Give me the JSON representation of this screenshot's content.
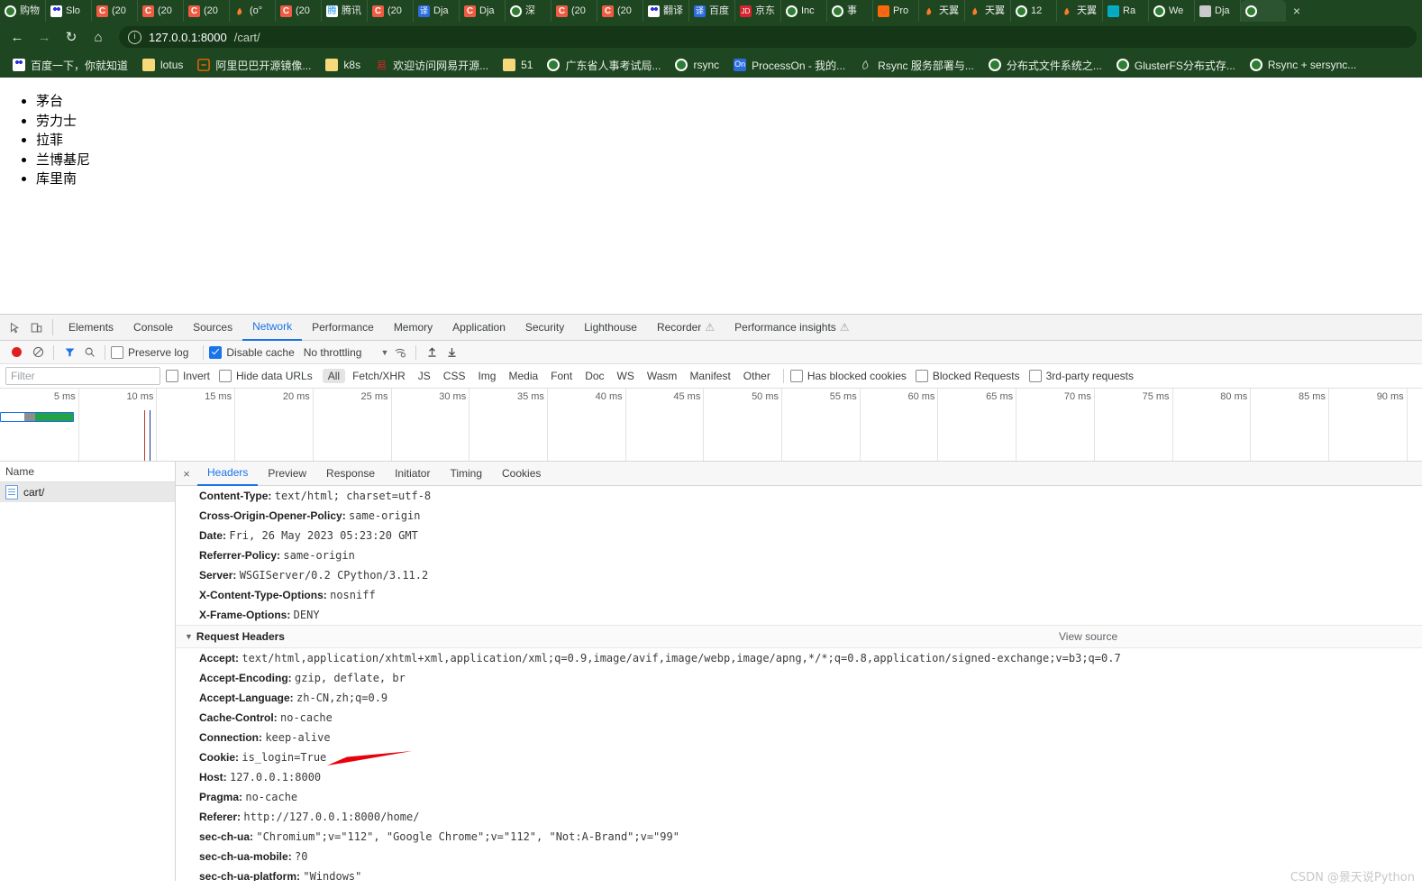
{
  "browser": {
    "tabs": [
      {
        "label": "购物",
        "icon": "globe-icon",
        "favicon_style": "fav-globe"
      },
      {
        "label": "Slo",
        "icon": "baidu-icon",
        "favicon_style": "fav-baidu"
      },
      {
        "label": "(20",
        "icon": "csdn-icon",
        "favicon_style": "fav-c"
      },
      {
        "label": "(20",
        "icon": "csdn-icon",
        "favicon_style": "fav-c"
      },
      {
        "label": "(20",
        "icon": "csdn-icon",
        "favicon_style": "fav-c"
      },
      {
        "label": "(o°",
        "icon": "firefly-icon",
        "favicon_style": "fav-firefly"
      },
      {
        "label": "(20",
        "icon": "csdn-icon",
        "favicon_style": "fav-c"
      },
      {
        "label": "腾讯",
        "icon": "tencent-icon",
        "favicon_style": "fav-tencent"
      },
      {
        "label": "(20",
        "icon": "csdn-icon",
        "favicon_style": "fav-c"
      },
      {
        "label": "Dja",
        "icon": "zhihu-icon",
        "favicon_style": "fav-blue"
      },
      {
        "label": "Dja",
        "icon": "csdn-icon",
        "favicon_style": "fav-c"
      },
      {
        "label": "深",
        "icon": "globe-icon",
        "favicon_style": "fav-globe"
      },
      {
        "label": "(20",
        "icon": "csdn-icon",
        "favicon_style": "fav-c"
      },
      {
        "label": "(20",
        "icon": "csdn-icon",
        "favicon_style": "fav-c"
      },
      {
        "label": "翻译",
        "icon": "baidu-icon",
        "favicon_style": "fav-baidu"
      },
      {
        "label": "百度",
        "icon": "translate-icon",
        "favicon_style": "fav-blue"
      },
      {
        "label": "京东",
        "icon": "jd-icon",
        "favicon_style": "fav-red"
      },
      {
        "label": "Inc",
        "icon": "globe-icon",
        "favicon_style": "fav-globe"
      },
      {
        "label": "事",
        "icon": "globe-icon",
        "favicon_style": "fav-globe"
      },
      {
        "label": "Pro",
        "icon": "gitlab-icon",
        "favicon_style": "fav-orange"
      },
      {
        "label": "天翼",
        "icon": "firefly-icon",
        "favicon_style": "fav-firefly"
      },
      {
        "label": "天翼",
        "icon": "firefly-icon",
        "favicon_style": "fav-firefly"
      },
      {
        "label": "12",
        "icon": "globe-icon",
        "favicon_style": "fav-globe"
      },
      {
        "label": "天翼",
        "icon": "firefly-icon",
        "favicon_style": "fav-firefly"
      },
      {
        "label": "Ra",
        "icon": "rancher-icon",
        "favicon_style": "fav-teal"
      },
      {
        "label": "We",
        "icon": "globe-icon",
        "favicon_style": "fav-globe"
      },
      {
        "label": "Dja",
        "icon": "django-icon",
        "favicon_style": "fav-plain"
      },
      {
        "label": "",
        "icon": "globe-icon",
        "favicon_style": "fav-globe",
        "active": true
      }
    ],
    "nav": {
      "back": "←",
      "forward": "→",
      "reload": "↻",
      "home": "⌂"
    },
    "omnibox": {
      "info_icon": "i",
      "host": "127.0.0.1:8000",
      "path": "/cart/"
    },
    "bookmarks": [
      {
        "label": "百度一下，你就知道",
        "favicon_style": "fav-baidu"
      },
      {
        "label": "lotus",
        "favicon_style": "fav-folder"
      },
      {
        "label": "阿里巴巴开源镜像...",
        "favicon_style": "fav-orange"
      },
      {
        "label": "k8s",
        "favicon_style": "fav-folder"
      },
      {
        "label": "欢迎访问网易开源...",
        "favicon_style": "fav-red"
      },
      {
        "label": "51",
        "favicon_style": "fav-folder"
      },
      {
        "label": "广东省人事考试局...",
        "favicon_style": "fav-globe"
      },
      {
        "label": "rsync",
        "favicon_style": "fav-globe"
      },
      {
        "label": "ProcessOn - 我的...",
        "favicon_style": "fav-blue"
      },
      {
        "label": "Rsync 服务部署与...",
        "favicon_style": "fav-firefly"
      },
      {
        "label": "分布式文件系统之...",
        "favicon_style": "fav-globe"
      },
      {
        "label": "GlusterFS分布式存...",
        "favicon_style": "fav-globe"
      },
      {
        "label": "Rsync + sersync...",
        "favicon_style": "fav-globe"
      }
    ]
  },
  "page": {
    "cart_items": [
      "茅台",
      "劳力士",
      "拉菲",
      "兰博基尼",
      "库里南"
    ]
  },
  "devtools": {
    "panels": [
      {
        "label": "Elements"
      },
      {
        "label": "Console"
      },
      {
        "label": "Sources"
      },
      {
        "label": "Network",
        "active": true
      },
      {
        "label": "Performance"
      },
      {
        "label": "Memory"
      },
      {
        "label": "Application"
      },
      {
        "label": "Security"
      },
      {
        "label": "Lighthouse"
      },
      {
        "label": "Recorder",
        "badge": "⚠"
      },
      {
        "label": "Performance insights",
        "badge": "⚠"
      }
    ],
    "toolbar": {
      "record_title": "record",
      "clear_title": "clear",
      "filter_title": "filter",
      "search_title": "search",
      "preserve_log_label": "Preserve log",
      "preserve_log_checked": false,
      "disable_cache_label": "Disable cache",
      "disable_cache_checked": true,
      "throttling_value": "No throttling",
      "throttling_caret": "▼",
      "import_title": "import HAR",
      "export_title": "export HAR"
    },
    "filterbar": {
      "filter_placeholder": "Filter",
      "invert_label": "Invert",
      "invert_checked": false,
      "hide_data_urls_label": "Hide data URLs",
      "hide_data_urls_checked": false,
      "types": [
        "All",
        "Fetch/XHR",
        "JS",
        "CSS",
        "Img",
        "Media",
        "Font",
        "Doc",
        "WS",
        "Wasm",
        "Manifest",
        "Other"
      ],
      "active_type": "All",
      "has_blocked_cookies_label": "Has blocked cookies",
      "has_blocked_cookies_checked": false,
      "blocked_requests_label": "Blocked Requests",
      "blocked_requests_checked": false,
      "third_party_label": "3rd-party requests",
      "third_party_checked": false
    },
    "timeline": {
      "ticks": [
        "5 ms",
        "10 ms",
        "15 ms",
        "20 ms",
        "25 ms",
        "30 ms",
        "35 ms",
        "40 ms",
        "45 ms",
        "50 ms",
        "55 ms",
        "60 ms",
        "65 ms",
        "70 ms",
        "75 ms",
        "80 ms",
        "85 ms",
        "90 ms"
      ]
    },
    "request_list": {
      "column_header": "Name",
      "rows": [
        {
          "name": "cart/",
          "icon": "document-icon",
          "selected": true
        }
      ]
    },
    "detail_tabs": [
      {
        "label": "Headers",
        "active": true
      },
      {
        "label": "Preview"
      },
      {
        "label": "Response"
      },
      {
        "label": "Initiator"
      },
      {
        "label": "Timing"
      },
      {
        "label": "Cookies"
      }
    ],
    "close_icon": "×",
    "response_headers": [
      {
        "key": "Content-Type:",
        "value": "text/html; charset=utf-8"
      },
      {
        "key": "Cross-Origin-Opener-Policy:",
        "value": "same-origin"
      },
      {
        "key": "Date:",
        "value": "Fri, 26 May 2023 05:23:20 GMT"
      },
      {
        "key": "Referrer-Policy:",
        "value": "same-origin"
      },
      {
        "key": "Server:",
        "value": "WSGIServer/0.2 CPython/3.11.2"
      },
      {
        "key": "X-Content-Type-Options:",
        "value": "nosniff"
      },
      {
        "key": "X-Frame-Options:",
        "value": "DENY"
      }
    ],
    "request_headers_section": {
      "title": "Request Headers",
      "caret": "▼",
      "view_source": "View source"
    },
    "request_headers": [
      {
        "key": "Accept:",
        "value": "text/html,application/xhtml+xml,application/xml;q=0.9,image/avif,image/webp,image/apng,*/*;q=0.8,application/signed-exchange;v=b3;q=0.7"
      },
      {
        "key": "Accept-Encoding:",
        "value": "gzip, deflate, br"
      },
      {
        "key": "Accept-Language:",
        "value": "zh-CN,zh;q=0.9"
      },
      {
        "key": "Cache-Control:",
        "value": "no-cache"
      },
      {
        "key": "Connection:",
        "value": "keep-alive"
      },
      {
        "key": "Cookie:",
        "value": "is_login=True"
      },
      {
        "key": "Host:",
        "value": "127.0.0.1:8000"
      },
      {
        "key": "Pragma:",
        "value": "no-cache"
      },
      {
        "key": "Referer:",
        "value": "http://127.0.0.1:8000/home/"
      },
      {
        "key": "sec-ch-ua:",
        "value": "\"Chromium\";v=\"112\", \"Google Chrome\";v=\"112\", \"Not:A-Brand\";v=\"99\""
      },
      {
        "key": "sec-ch-ua-mobile:",
        "value": "?0"
      },
      {
        "key": "sec-ch-ua-platform:",
        "value": "\"Windows\""
      }
    ]
  },
  "annotation": {
    "arrow_color": "#e8000a",
    "target": "Cookie: is_login=True"
  },
  "watermark": {
    "text": "CSDN @景天说Python"
  }
}
